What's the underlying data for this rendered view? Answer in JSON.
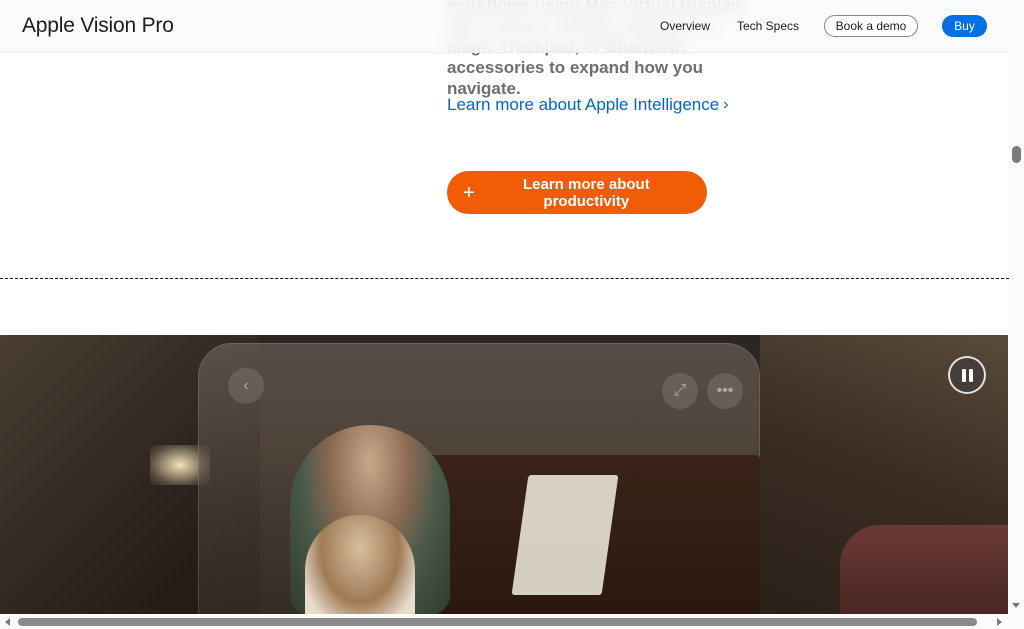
{
  "header": {
    "brand": "Apple Vision Pro",
    "nav": [
      {
        "label": "Overview"
      },
      {
        "label": "Tech Specs"
      }
    ],
    "book_demo_label": "Book a demo",
    "buy_label": "Buy"
  },
  "content": {
    "paragraph": "workflows using Mac Virtual Display, and connect a Magic Keyboard, a Magic Trackpad, or Bluetooth accessories to expand how you navigate.",
    "learn_link": {
      "label": "Learn more about Apple Intelligence",
      "chevron": "›"
    },
    "cta": {
      "icon": "plus-icon",
      "label": "Learn more about productivity"
    }
  },
  "media": {
    "pause_icon": "pause-icon",
    "overlay_icons": [
      "back-icon",
      "expand-icon",
      "more-icon"
    ]
  }
}
